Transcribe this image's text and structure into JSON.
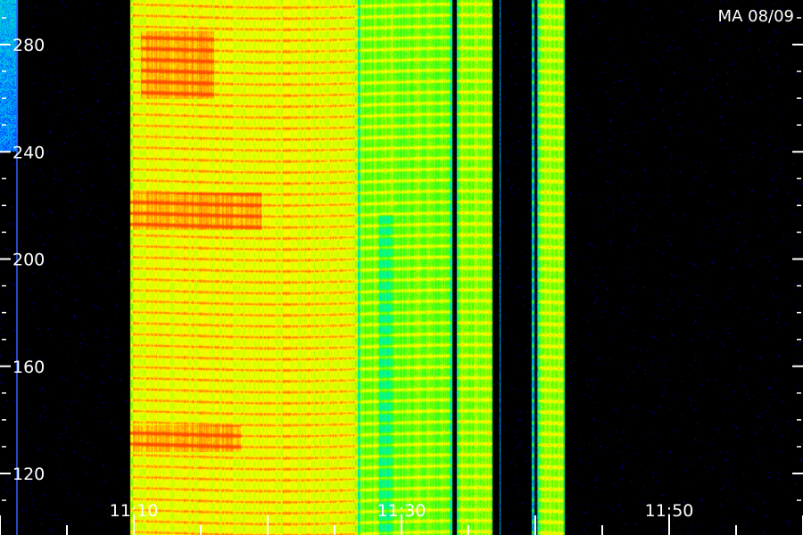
{
  "chart_data": {
    "type": "heatmap",
    "title": "MA 08/09",
    "xlabel": "",
    "ylabel": "",
    "x_range_minutes": [
      "11:00",
      "12:00"
    ],
    "x_tick_labels": [
      {
        "label": "11:10",
        "t_min": 10
      },
      {
        "label": "11:30",
        "t_min": 30
      },
      {
        "label": "11:50",
        "t_min": 50
      }
    ],
    "y_range": [
      100,
      300
    ],
    "y_tick_labels": [
      {
        "label": "280",
        "value": 280
      },
      {
        "label": "240",
        "value": 240
      },
      {
        "label": "200",
        "value": 200
      },
      {
        "label": "160",
        "value": 160
      },
      {
        "label": "120",
        "value": 120
      }
    ],
    "colormap": [
      "#000000",
      "#1a0080",
      "#0000ff",
      "#00b4ff",
      "#00ff90",
      "#40ff00",
      "#c8ff00",
      "#ffff00",
      "#ffa000",
      "#ff5000"
    ],
    "signal_segments_min": [
      {
        "start": 9.7,
        "end": 26.7,
        "level": 0.72
      },
      {
        "start": 26.7,
        "end": 33.8,
        "level": 0.58
      },
      {
        "start": 34.1,
        "end": 36.8,
        "level": 0.6
      },
      {
        "start": 39.7,
        "end": 39.9,
        "level": 0.45
      },
      {
        "start": 40.2,
        "end": 42.2,
        "level": 0.6
      }
    ],
    "hot_bands": [
      {
        "y_from": 211,
        "y_to": 225,
        "t_start": 9.7,
        "t_end": 19.5
      },
      {
        "y_from": 260,
        "y_to": 285,
        "t_start": 10.5,
        "t_end": 16.0
      },
      {
        "y_from": 128,
        "y_to": 138,
        "t_start": 9.7,
        "t_end": 18.0
      }
    ],
    "band_spacing_value": 4.1,
    "grid": false,
    "legend": "none"
  }
}
